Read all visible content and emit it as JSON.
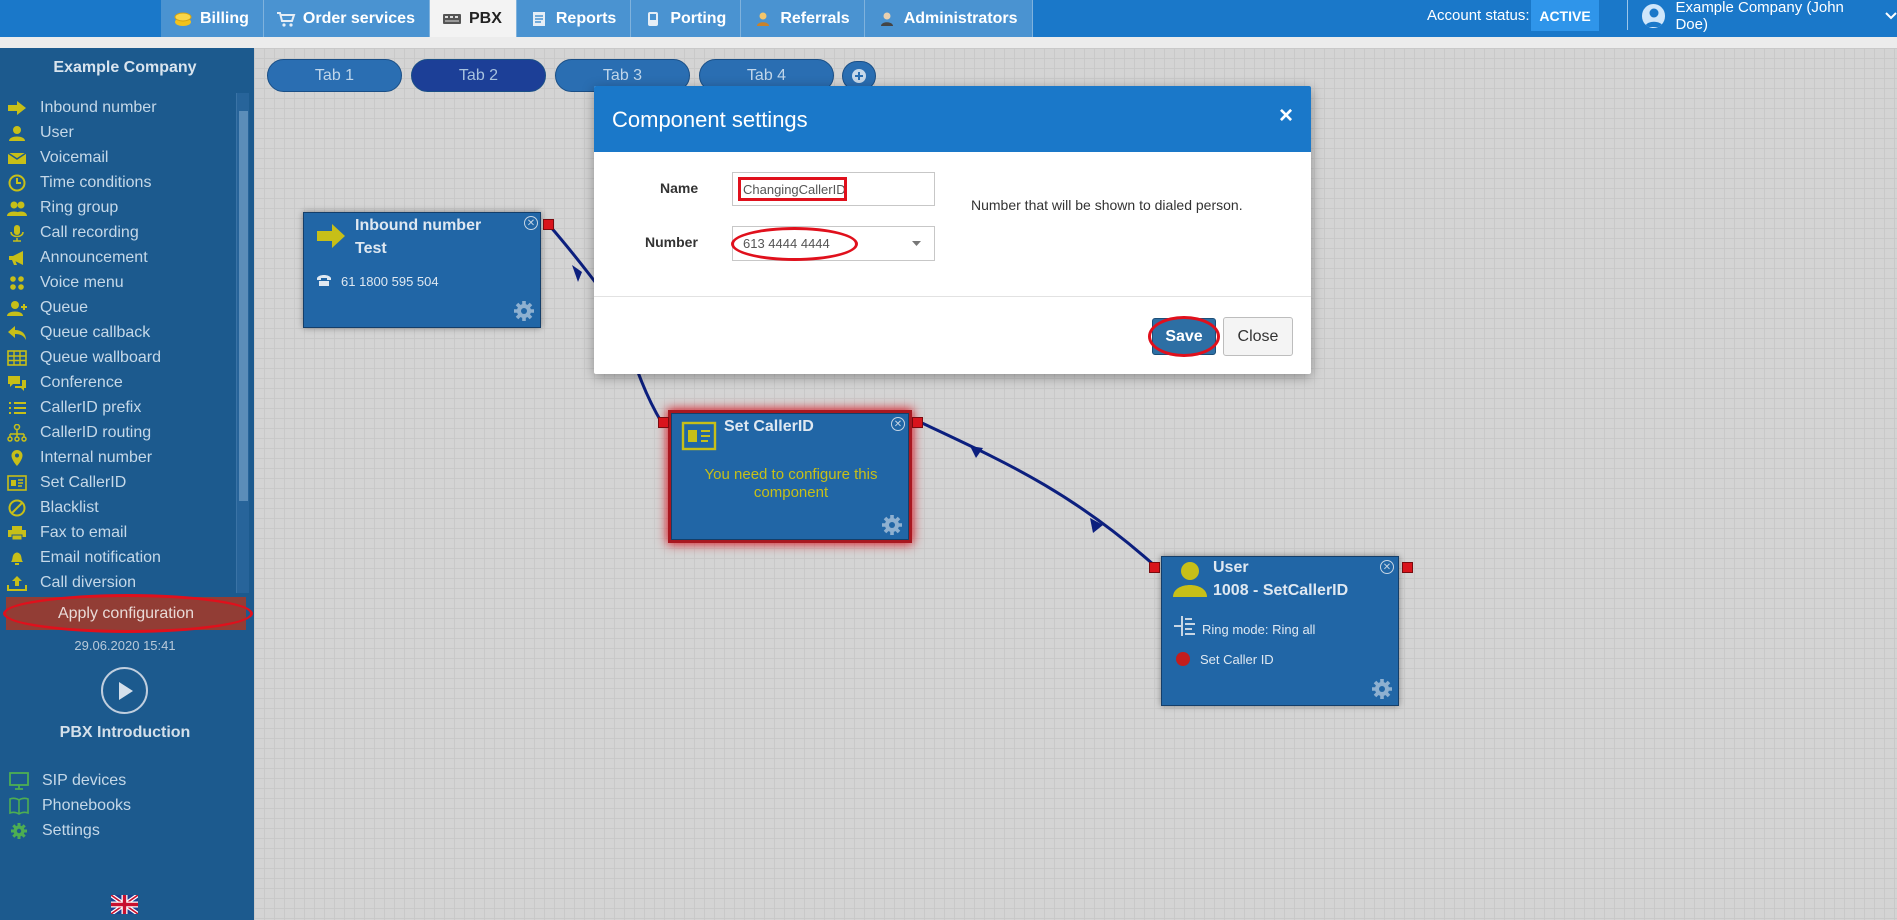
{
  "nav": {
    "tabs": [
      {
        "label": "Billing",
        "icon": "coins-icon"
      },
      {
        "label": "Order services",
        "icon": "cart-icon"
      },
      {
        "label": "PBX",
        "icon": "pbx-icon",
        "active": true
      },
      {
        "label": "Reports",
        "icon": "report-icon"
      },
      {
        "label": "Porting",
        "icon": "porting-icon"
      },
      {
        "label": "Referrals",
        "icon": "referrals-icon"
      },
      {
        "label": "Administrators",
        "icon": "admin-icon"
      }
    ]
  },
  "account": {
    "status_label": "Account status:",
    "status_value": "ACTIVE",
    "user": "Example Company (John Doe)"
  },
  "sidebar": {
    "title": "Example Company",
    "items": [
      {
        "label": "Inbound number",
        "icon": "arrow-right-icon"
      },
      {
        "label": "User",
        "icon": "user-icon"
      },
      {
        "label": "Voicemail",
        "icon": "envelope-icon"
      },
      {
        "label": "Time conditions",
        "icon": "clock-icon"
      },
      {
        "label": "Ring group",
        "icon": "group-icon"
      },
      {
        "label": "Call recording",
        "icon": "microphone-icon"
      },
      {
        "label": "Announcement",
        "icon": "megaphone-icon"
      },
      {
        "label": "Voice menu",
        "icon": "grid-icon"
      },
      {
        "label": "Queue",
        "icon": "user-plus-icon"
      },
      {
        "label": "Queue callback",
        "icon": "reply-icon"
      },
      {
        "label": "Queue wallboard",
        "icon": "table-icon"
      },
      {
        "label": "Conference",
        "icon": "chat-icon"
      },
      {
        "label": "CallerID prefix",
        "icon": "list-icon"
      },
      {
        "label": "CallerID routing",
        "icon": "sitemap-icon"
      },
      {
        "label": "Internal number",
        "icon": "pin-icon"
      },
      {
        "label": "Set CallerID",
        "icon": "id-card-icon"
      },
      {
        "label": "Blacklist",
        "icon": "ban-icon"
      },
      {
        "label": "Fax to email",
        "icon": "printer-icon"
      },
      {
        "label": "Email notification",
        "icon": "bell-icon"
      },
      {
        "label": "Call diversion",
        "icon": "upload-icon"
      }
    ],
    "apply_label": "Apply configuration",
    "apply_date": "29.06.2020 15:41",
    "intro_label": "PBX Introduction",
    "bottom_items": [
      {
        "label": "SIP devices",
        "icon": "monitor-icon"
      },
      {
        "label": "Phonebooks",
        "icon": "book-icon"
      },
      {
        "label": "Settings",
        "icon": "gear-icon"
      }
    ]
  },
  "canvas": {
    "tabs": [
      "Tab 1",
      "Tab 2",
      "Tab 3",
      "Tab 4"
    ],
    "active_tab": 1,
    "nodes": {
      "inbound": {
        "title1": "Inbound number",
        "title2": "Test",
        "phone": "61 1800 595 504"
      },
      "setcallerid": {
        "title": "Set CallerID",
        "message": "You need to configure this component"
      },
      "user": {
        "title1": "User",
        "title2": "1008 - SetCallerID",
        "ring_mode": "Ring mode: Ring all",
        "status": "Set Caller ID"
      }
    }
  },
  "modal": {
    "title": "Component settings",
    "name_label": "Name",
    "name_value": "ChangingCallerID",
    "number_label": "Number",
    "number_value": "613 4444 4444",
    "hint": "Number that will be shown to dialed person.",
    "save_label": "Save",
    "close_label": "Close"
  },
  "colors": {
    "accent": "#1a78c9",
    "sidebar": "#1c5a8e",
    "highlight": "#e0101c"
  }
}
